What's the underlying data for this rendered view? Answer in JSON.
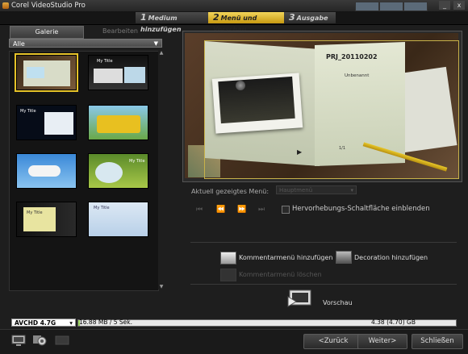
{
  "window": {
    "title": "Corel VideoStudio Pro",
    "minimize": "_",
    "close": "x"
  },
  "steps": [
    {
      "num": "1",
      "label": "Medium hinzufügen"
    },
    {
      "num": "2",
      "label": "Menü und Vorschau"
    },
    {
      "num": "3",
      "label": "Ausgabe"
    }
  ],
  "left": {
    "tab_gallery": "Galerie",
    "tab_edit": "Bearbeiten",
    "filter": "Alle",
    "thumbs": [
      {
        "label": ""
      },
      {
        "label": "My Title"
      },
      {
        "label": "My Title"
      },
      {
        "label": ""
      },
      {
        "label": ""
      },
      {
        "label": "My Title"
      },
      {
        "label": "My Title"
      },
      {
        "label": "My Title"
      }
    ]
  },
  "preview": {
    "project_title": "PRJ_20110202",
    "subtitle": "Unbenannt",
    "page": "1/1",
    "play": "▶"
  },
  "controls": {
    "menu_label": "Aktuell gezeigtes Menü:",
    "menu_value": "Hauptmenü",
    "first": "⏮",
    "prev": "⏪",
    "next": "⏩",
    "last": "⏭",
    "highlight_label": "Hervorhebungs-Schaltfläche einblenden"
  },
  "actions": {
    "add_submenu": "Kommentarmenü hinzufügen",
    "add_decoration": "Decoration hinzufügen",
    "delete_submenu": "Kommentarmenü löschen",
    "preview": "Vorschau"
  },
  "status": {
    "format": "AVCHD 4.7G",
    "used": "16.88 MB / 5 Sek.",
    "total": "4.38 (4.70) GB",
    "used_fraction": 0.004
  },
  "bottom": {
    "back": "<Zurück",
    "next": "Weiter>",
    "close": "Schließen"
  }
}
